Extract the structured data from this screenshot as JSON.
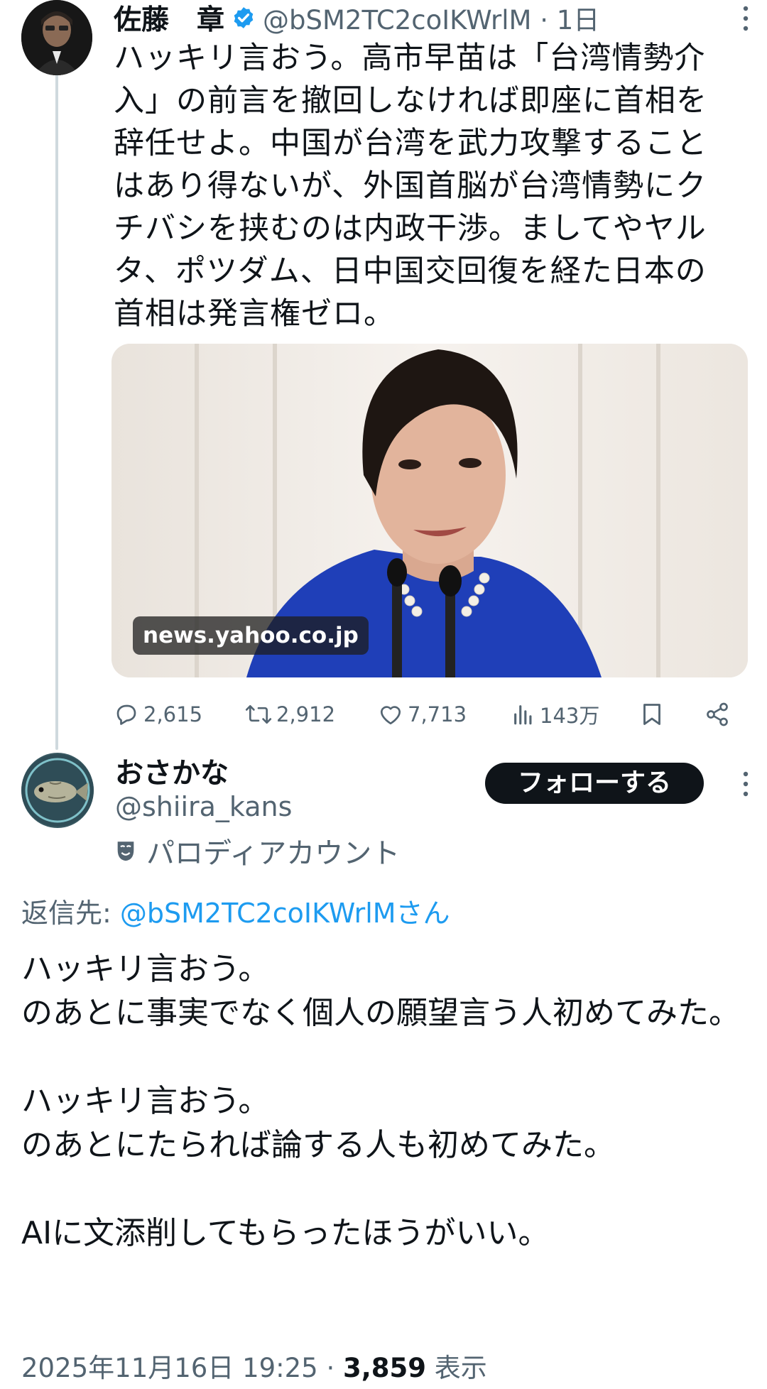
{
  "post1": {
    "author_name": "佐藤　章",
    "handle_time": "@bSM2TC2coIKWrlM · 1日",
    "text": "ハッキリ言おう。高市早苗は「台湾情勢介入」の前言を撤回しなければ即座に首相を辞任せよ。中国が台湾を武力攻撃することはあり得ないが、外国首脳が台湾情勢にクチバシを挟むのは内政干渉。ましてやヤルタ、ポツダム、日中国交回復を経た日本の首相は発言権ゼロ。",
    "media_label": "news.yahoo.co.jp",
    "replies": "2,615",
    "reposts": "2,912",
    "likes": "7,713",
    "views": "143万"
  },
  "post2": {
    "author_name": "おさかな",
    "handle": "@shiira_kans",
    "parody_label": "パロディアカウント",
    "follow_label": "フォローする",
    "reply_to_prefix": "返信先: ",
    "reply_to_mention": "@bSM2TC2coIKWrlMさん",
    "text": "ハッキリ言おう。\nのあとに事実でなく個人の願望言う人初めてみた。\n\nハッキリ言おう。\nのあとにたられば論する人も初めてみた。\n\nAIに文添削してもらったほうがいい。",
    "timestamp": "2025年11月16日 19:25 · ",
    "view_count": "3,859",
    "view_suffix": " 表示"
  },
  "colors": {
    "text": "#0f1419",
    "secondary": "#536471",
    "link": "#1d9bf0",
    "verified": "#1d9bf0",
    "thread_line": "#cfd9de"
  }
}
